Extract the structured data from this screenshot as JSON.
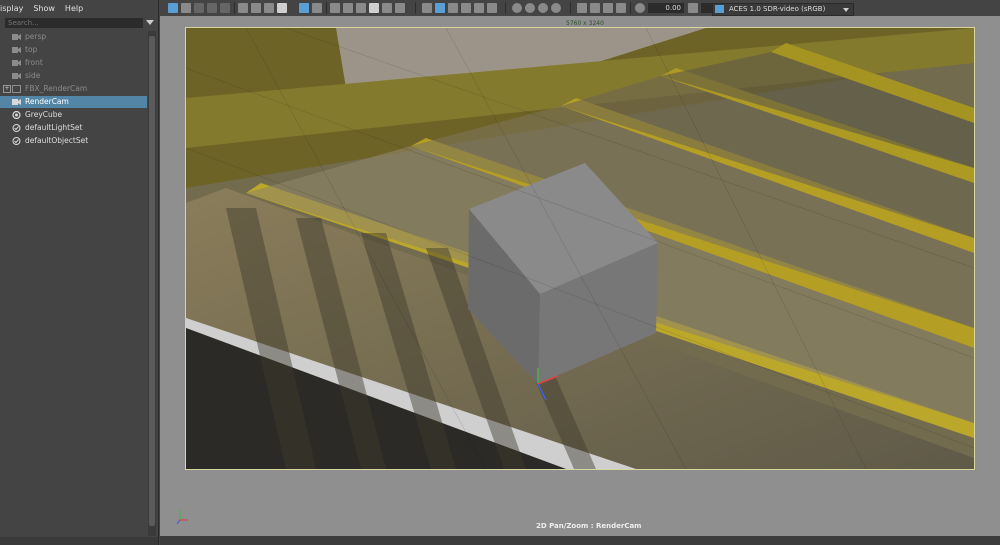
{
  "menubar": {
    "items": [
      "isplay",
      "Show",
      "Help"
    ]
  },
  "search": {
    "placeholder": "Search..."
  },
  "outliner": {
    "items": [
      {
        "label": "persp",
        "icon": "camera-icon",
        "dim": true
      },
      {
        "label": "top",
        "icon": "camera-icon",
        "dim": true
      },
      {
        "label": "front",
        "icon": "camera-icon",
        "dim": true
      },
      {
        "label": "side",
        "icon": "camera-icon",
        "dim": true
      },
      {
        "label": "FBX_RenderCam",
        "icon": "group-icon",
        "dim": true,
        "expander": "+"
      },
      {
        "label": "RenderCam",
        "icon": "camera-icon",
        "selected": true
      },
      {
        "label": "GreyCube",
        "icon": "mesh-icon"
      },
      {
        "label": "defaultLightSet",
        "icon": "set-icon"
      },
      {
        "label": "defaultObjectSet",
        "icon": "set-icon"
      }
    ]
  },
  "toolbar": {
    "exposure": "0.00",
    "gamma": "1.00",
    "color_space": "ACES 1.0 SDR-video (sRGB)"
  },
  "viewport": {
    "resolution_label": "5760 x 3240",
    "hud_label": "2D Pan/Zoom : RenderCam"
  },
  "colors": {
    "selection": "#5285a6",
    "accent_blue": "#5a9fd4",
    "stair_yellow": "#b9a21e"
  }
}
